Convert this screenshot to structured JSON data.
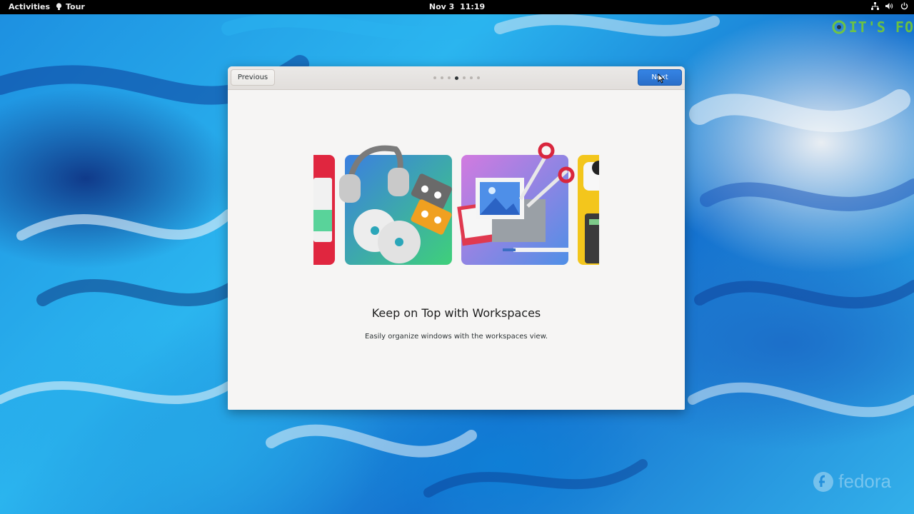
{
  "topbar": {
    "activities": "Activities",
    "app_name": "Tour",
    "clock_date": "Nov 3",
    "clock_time": "11:19",
    "tray_icons": [
      "network-icon",
      "volume-icon",
      "power-icon"
    ]
  },
  "dialog": {
    "previous_label": "Previous",
    "next_label": "Next",
    "page_count": 7,
    "current_page": 4,
    "slide_title": "Keep on Top with Workspaces",
    "slide_description": "Easily organize windows with the workspaces view."
  },
  "watermark": {
    "text": "IT'S FO"
  },
  "branding": {
    "text": "fedora"
  },
  "colors": {
    "accent": "#3584e4",
    "dialog_bg": "#f6f5f4",
    "topbar_bg": "#000000"
  }
}
